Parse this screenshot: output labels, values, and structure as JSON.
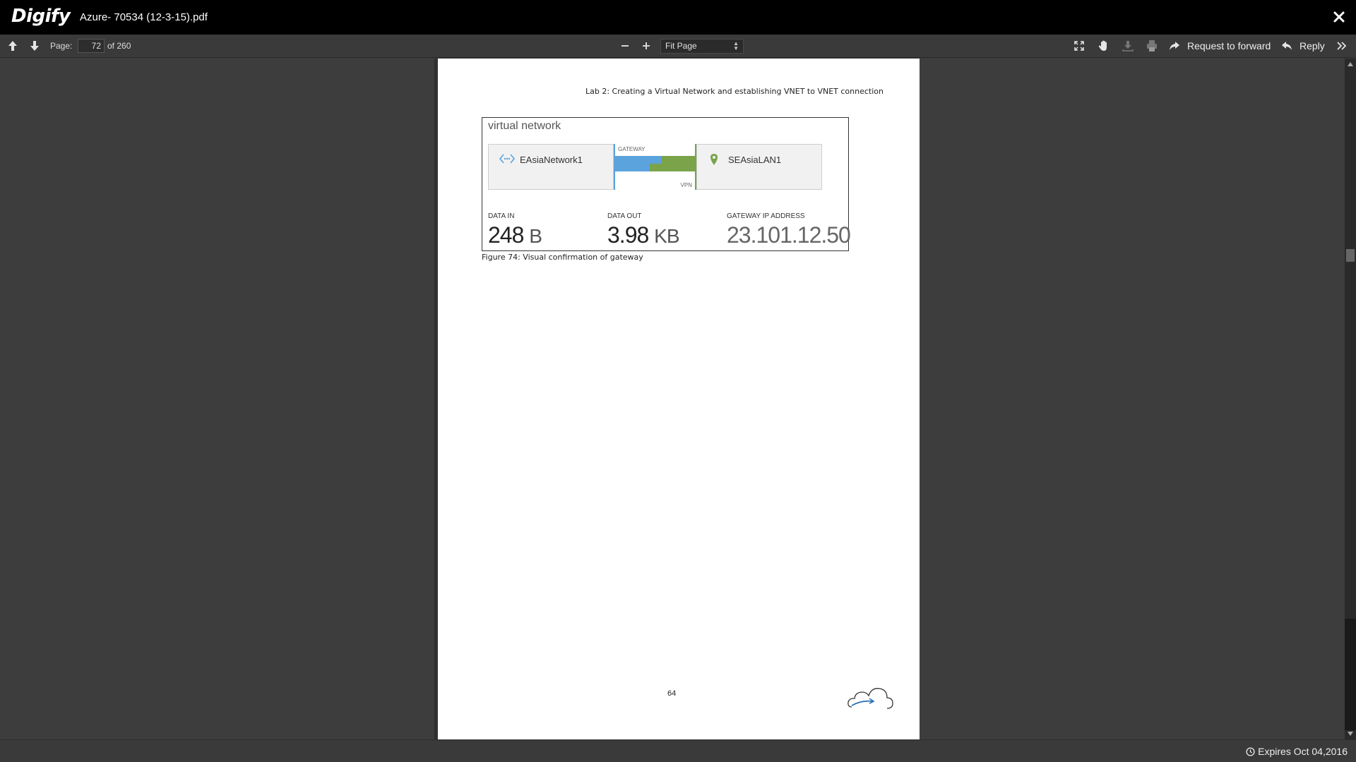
{
  "app": {
    "brand": "Digify",
    "document_title": "Azure- 70534 (12-3-15).pdf"
  },
  "toolbar": {
    "page_label": "Page:",
    "current_page": "72",
    "of_text": "of 260",
    "zoom_value": "Fit Page",
    "forward_label": "Request to forward",
    "reply_label": "Reply"
  },
  "page": {
    "header": "Lab 2: Creating a Virtual Network and establishing VNET to VNET connection",
    "figure": {
      "title": "virtual network",
      "left_network": "EAsiaNetwork1",
      "right_network": "SEAsiaLAN1",
      "gateway_label": "GATEWAY",
      "vpn_label": "VPN",
      "data_in_label": "DATA IN",
      "data_in_value": "248",
      "data_in_unit": "B",
      "data_out_label": "DATA OUT",
      "data_out_value": "3.98",
      "data_out_unit": "KB",
      "gateway_ip_label": "GATEWAY IP ADDRESS",
      "gateway_ip_value": "23.101.12.50",
      "colors": {
        "blue": "#5ba3dc",
        "green": "#7aa34a"
      }
    },
    "caption": "Figure 74: Visual confirmation of gateway",
    "page_number": "64"
  },
  "status": {
    "expires_text": "Expires Oct 04,2016"
  }
}
